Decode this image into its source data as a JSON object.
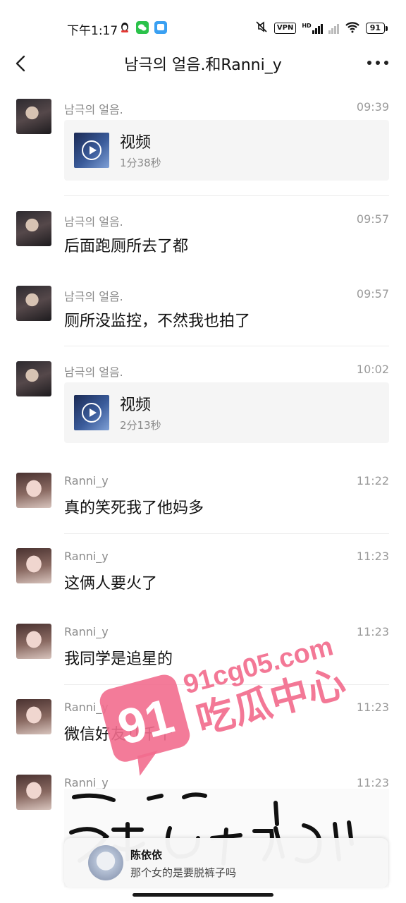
{
  "status_bar": {
    "time": "下午1:17",
    "vpn": "VPN",
    "battery": "91",
    "hd": "HD"
  },
  "header": {
    "title": "남극의 얼음.和Ranni_y"
  },
  "messages": [
    {
      "sender": "남극의 얼음.",
      "time": "09:39",
      "kind": "video",
      "video_label": "视频",
      "duration": "1分38秒"
    },
    {
      "sender": "남극의 얼음.",
      "time": "09:57",
      "kind": "text",
      "text": "后面跑厕所去了都"
    },
    {
      "sender": "남극의 얼음.",
      "time": "09:57",
      "kind": "text",
      "text": "厕所没监控，不然我也拍了"
    },
    {
      "sender": "남극의 얼음.",
      "time": "10:02",
      "kind": "video",
      "video_label": "视频",
      "duration": "2分13秒"
    },
    {
      "sender": "Ranni_y",
      "time": "11:22",
      "kind": "text",
      "text": "真的笑死我了他妈多"
    },
    {
      "sender": "Ranni_y",
      "time": "11:23",
      "kind": "text",
      "text": "这俩人要火了"
    },
    {
      "sender": "Ranni_y",
      "time": "11:23",
      "kind": "text",
      "text": "我同学是追星的"
    },
    {
      "sender": "Ranni_y",
      "time": "11:23",
      "kind": "text",
      "text": "微信好友几千个"
    },
    {
      "sender": "Ranni_y",
      "time": "11:23",
      "kind": "image"
    }
  ],
  "notification": {
    "name": "陈依依",
    "text": "那个女的是要脱裤子吗"
  },
  "watermark": {
    "number": "91",
    "domain": "91cg05.com",
    "brand": "吃瓜中心",
    "color": "#f26d8e"
  }
}
